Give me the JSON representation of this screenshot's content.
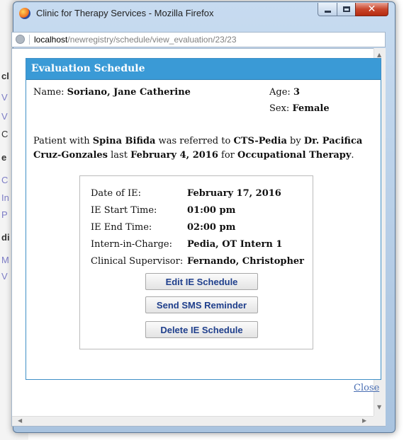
{
  "background_page": {
    "items": [
      {
        "text": "cl",
        "style": "bold"
      },
      {
        "text": "V",
        "style": "link"
      },
      {
        "text": "V",
        "style": "link"
      },
      {
        "text": "C",
        "style": "text"
      },
      {
        "text": "e",
        "style": "bold"
      },
      {
        "text": "C",
        "style": "link"
      },
      {
        "text": "In",
        "style": "link"
      },
      {
        "text": "P",
        "style": "link"
      },
      {
        "text": "di",
        "style": "bold"
      },
      {
        "text": "M",
        "style": "link"
      },
      {
        "text": "V",
        "style": "link"
      }
    ]
  },
  "window": {
    "title": "Clinic for Therapy Services - Mozilla Firefox",
    "url_host": "localhost",
    "url_path": "/newregistry/schedule/view_evaluation/23/23"
  },
  "dialog": {
    "title": "Evaluation Schedule",
    "name_label": "Name:",
    "name_value": "Soriano, Jane Catherine",
    "age_label": "Age:",
    "age_value": "3",
    "sex_label": "Sex:",
    "sex_value": "Female",
    "referral": {
      "t1": "Patient with ",
      "condition": "Spina Bifida",
      "t2": " was referred to ",
      "department": "CTS-Pedia",
      "t3": " by ",
      "doctor_line1": "Dr. Pacifica",
      "doctor_line2": "Cruz-Gonzales",
      "t4": " last ",
      "date": "February 4, 2016",
      "t5": " for ",
      "therapy": "Occupational Therapy",
      "t6": "."
    },
    "schedule": [
      {
        "label": "Date of IE:",
        "value": "February 17, 2016"
      },
      {
        "label": "IE Start Time:",
        "value": "01:00 pm"
      },
      {
        "label": "IE End Time:",
        "value": "02:00 pm"
      },
      {
        "label": "Intern-in-Charge:",
        "value": "Pedia, OT Intern 1"
      },
      {
        "label": "Clinical Supervisor:",
        "value": "Fernando, Christopher"
      }
    ],
    "buttons": {
      "edit": "Edit IE Schedule",
      "sms": "Send SMS Reminder",
      "delete": "Delete IE Schedule"
    },
    "close_link": "Close"
  },
  "colors": {
    "dialog_header": "#3a9ad6",
    "button_text": "#1f3f8c",
    "link": "#4a6fb3"
  }
}
